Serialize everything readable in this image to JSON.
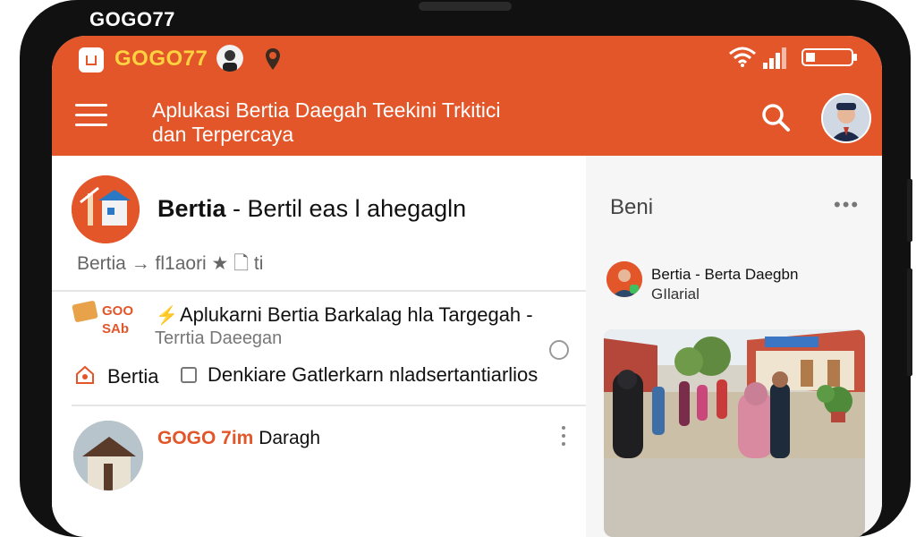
{
  "overlay_brand": "GOGO77",
  "status": {
    "brand_title": "GOGO77"
  },
  "header": {
    "headline_line1": "Aplukasi Bertia Daegah Teekini Trkitici",
    "headline_line2": "dan Terpercaya"
  },
  "post": {
    "title_bold": "Bertia",
    "title_rest": " - Bertil eas l ahegagln",
    "meta_text": "Bertia  →  fl1aori  ★  🗋 ti"
  },
  "notification": {
    "logo_text_1": "GOO",
    "logo_text_2": "SAb",
    "title": "Aplukarni Bertia Barkalag hla Targegah -",
    "subtitle": "Terrtia Daeegan"
  },
  "item": {
    "label": "Bertia",
    "text": "Denkiare Gatlerkarn nladsertantiarlios"
  },
  "row2": {
    "title_orange": "GOGO 7im",
    "title_rest": " Daragh"
  },
  "side_panel": {
    "title": "Beni",
    "more": "•••",
    "card_title": "Bertia - Berta Daegbn",
    "card_sub": "GIlarial"
  },
  "colors": {
    "brand_orange": "#e2562a",
    "brand_yellow": "#ffd23f"
  }
}
